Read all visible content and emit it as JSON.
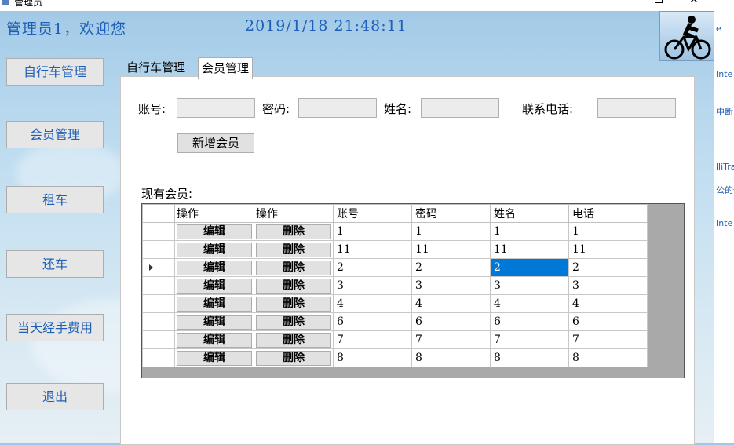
{
  "window": {
    "title": "管理员"
  },
  "header": {
    "welcome": "管理员1，欢迎您",
    "datetime": "2019/1/18  21:48:11"
  },
  "sidebar": {
    "items": [
      {
        "label": "自行车管理"
      },
      {
        "label": "会员管理"
      },
      {
        "label": "租车"
      },
      {
        "label": "还车"
      },
      {
        "label": "当天经手费用"
      },
      {
        "label": "退出"
      }
    ]
  },
  "tabs": [
    {
      "label": "自行车管理"
    },
    {
      "label": "会员管理"
    }
  ],
  "form": {
    "account_label": "账号:",
    "password_label": "密码:",
    "name_label": "姓名:",
    "phone_label": "联系电话:",
    "add_button": "新增会员"
  },
  "grid": {
    "caption": "现有会员:",
    "columns": [
      "操作",
      "操作",
      "账号",
      "密码",
      "姓名",
      "电话"
    ],
    "edit_label": "编辑",
    "delete_label": "删除",
    "rows": [
      [
        "1",
        "1",
        "1",
        "1"
      ],
      [
        "11",
        "11",
        "11",
        "11"
      ],
      [
        "2",
        "2",
        "2",
        "2"
      ],
      [
        "3",
        "3",
        "3",
        "3"
      ],
      [
        "4",
        "4",
        "4",
        "4"
      ],
      [
        "6",
        "6",
        "6",
        "6"
      ],
      [
        "7",
        "7",
        "7",
        "7"
      ],
      [
        "8",
        "8",
        "8",
        "8"
      ]
    ],
    "current_row": 2,
    "selected_cell": "姓名"
  },
  "background_window": {
    "fragments": [
      "e",
      "Inte",
      "中断",
      "lliTra",
      "公的代",
      "Inte"
    ]
  },
  "colors": {
    "accent": "#1f5fb8",
    "selection": "#0078d7"
  }
}
